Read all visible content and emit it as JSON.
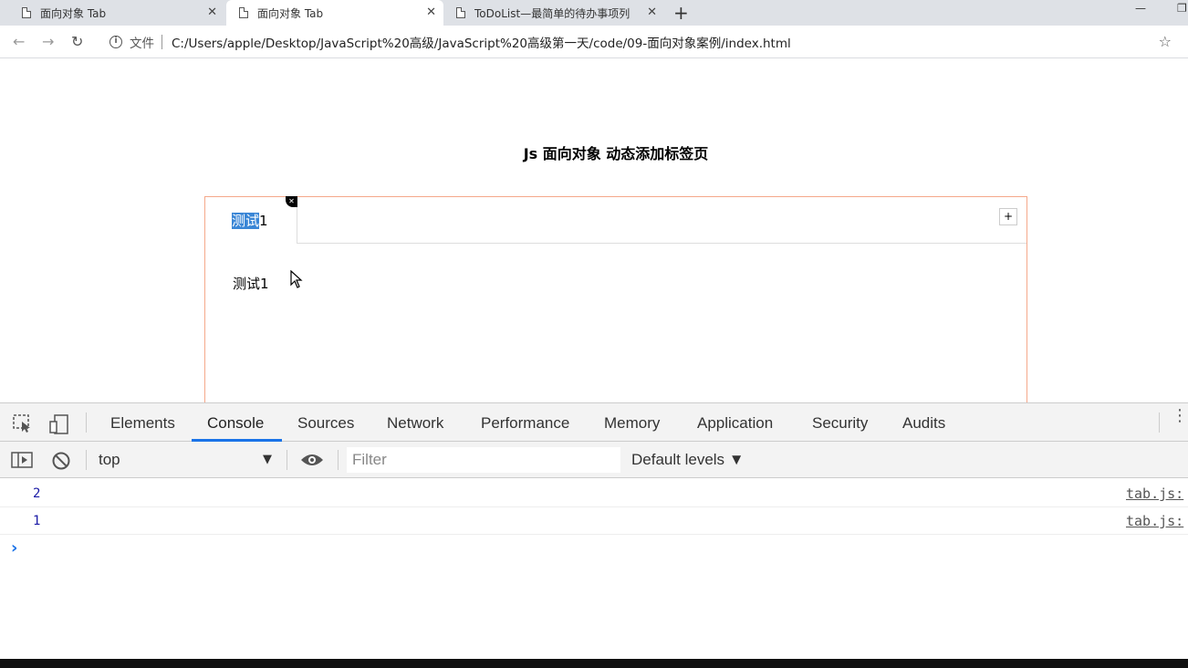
{
  "browser": {
    "tabs": [
      {
        "title": "面向对象 Tab",
        "active": false
      },
      {
        "title": "面向对象 Tab",
        "active": true
      },
      {
        "title": "ToDoList—最简单的待办事项列",
        "active": false
      }
    ],
    "new_tab_label": "+",
    "url_scheme_label": "文件",
    "url": "C:/Users/apple/Desktop/JavaScript%20高级/JavaScript%20高级第一天/code/09-面向对象案例/index.html"
  },
  "page": {
    "title": "Js 面向对象 动态添加标签页",
    "tab_label_selected": "测试",
    "tab_label_rest": "1",
    "close_symbol": "✕",
    "add_symbol": "+",
    "content_text": "测试1"
  },
  "devtools": {
    "tabs": [
      "Elements",
      "Console",
      "Sources",
      "Network",
      "Performance",
      "Memory",
      "Application",
      "Security",
      "Audits"
    ],
    "active_tab": "Console",
    "context": "top",
    "filter_placeholder": "Filter",
    "levels_label": "Default levels ▼",
    "logs": [
      {
        "value": "2",
        "source": "tab.js:"
      },
      {
        "value": "1",
        "source": "tab.js:"
      }
    ],
    "prompt_symbol": "›"
  },
  "colors": {
    "accent": "#1a73e8",
    "tabsbox_border": "#f5a88a",
    "selection": "#3a86d6"
  }
}
